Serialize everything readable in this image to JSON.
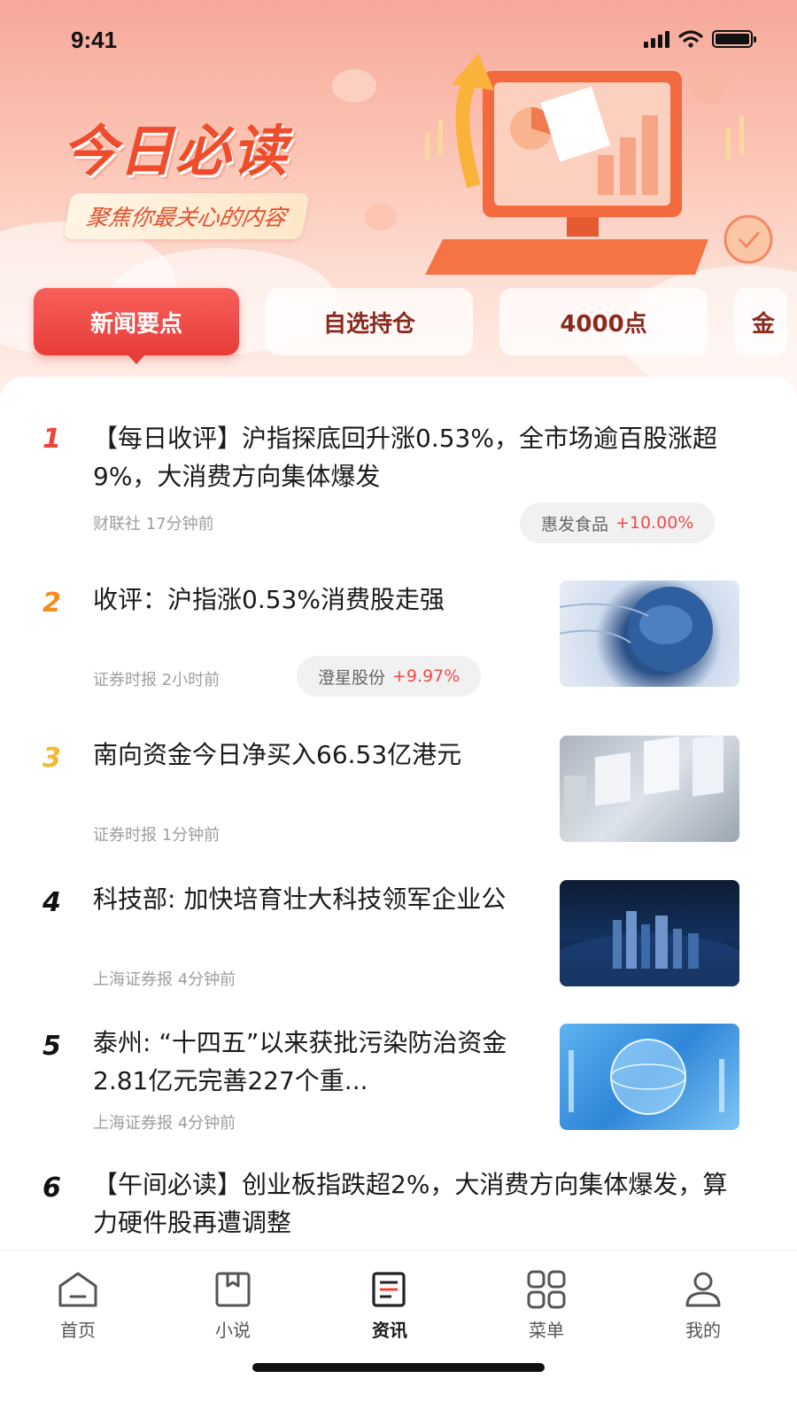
{
  "status_bar": {
    "time": "9:41"
  },
  "header": {
    "title": "今日必读",
    "subtitle": "聚焦你最关心的内容"
  },
  "tabs": [
    {
      "label": "新闻要点",
      "active": true
    },
    {
      "label": "自选持仓",
      "active": false
    },
    {
      "label": "4000点",
      "active": false
    },
    {
      "label": "金",
      "active": false
    }
  ],
  "news": [
    {
      "rank": "1",
      "rank_color": "#f0443a",
      "title": "【每日收评】沪指探底回升涨0.53%，全市场逾百股涨超9%，大消费方向集体爆发",
      "source": "财联社",
      "time": "17分钟前",
      "stock": {
        "name": "惠发食品",
        "change": "+10.00%"
      }
    },
    {
      "rank": "2",
      "rank_color": "#f58a1f",
      "title": "收评：沪指涨0.53%消费股走强",
      "source": "证券时报",
      "time": "2小时前",
      "stock": {
        "name": "澄星股份",
        "change": "+9.97%"
      }
    },
    {
      "rank": "3",
      "rank_color": "#f5b82e",
      "title": "南向资金今日净买入66.53亿港元",
      "source": "证券时报",
      "time": "1分钟前"
    },
    {
      "rank": "4",
      "rank_color": "#111111",
      "title": "科技部: 加快培育壮大科技领军企业公",
      "source": "上海证券报",
      "time": "4分钟前"
    },
    {
      "rank": "5",
      "rank_color": "#111111",
      "title": "泰州: “十四五”以来获批污染防治资金2.81亿元完善227个重...",
      "source": "上海证券报",
      "time": "4分钟前"
    },
    {
      "rank": "6",
      "rank_color": "#111111",
      "title": "【午间必读】创业板指跌超2%，大消费方向集体爆发，算力硬件股再遭调整"
    }
  ],
  "tabbar": [
    {
      "label": "首页",
      "icon": "home-icon",
      "active": false
    },
    {
      "label": "小说",
      "icon": "book-icon",
      "active": false
    },
    {
      "label": "资讯",
      "icon": "news-icon",
      "active": true
    },
    {
      "label": "菜单",
      "icon": "grid-menu-icon",
      "active": false
    },
    {
      "label": "我的",
      "icon": "user-icon",
      "active": false
    }
  ]
}
